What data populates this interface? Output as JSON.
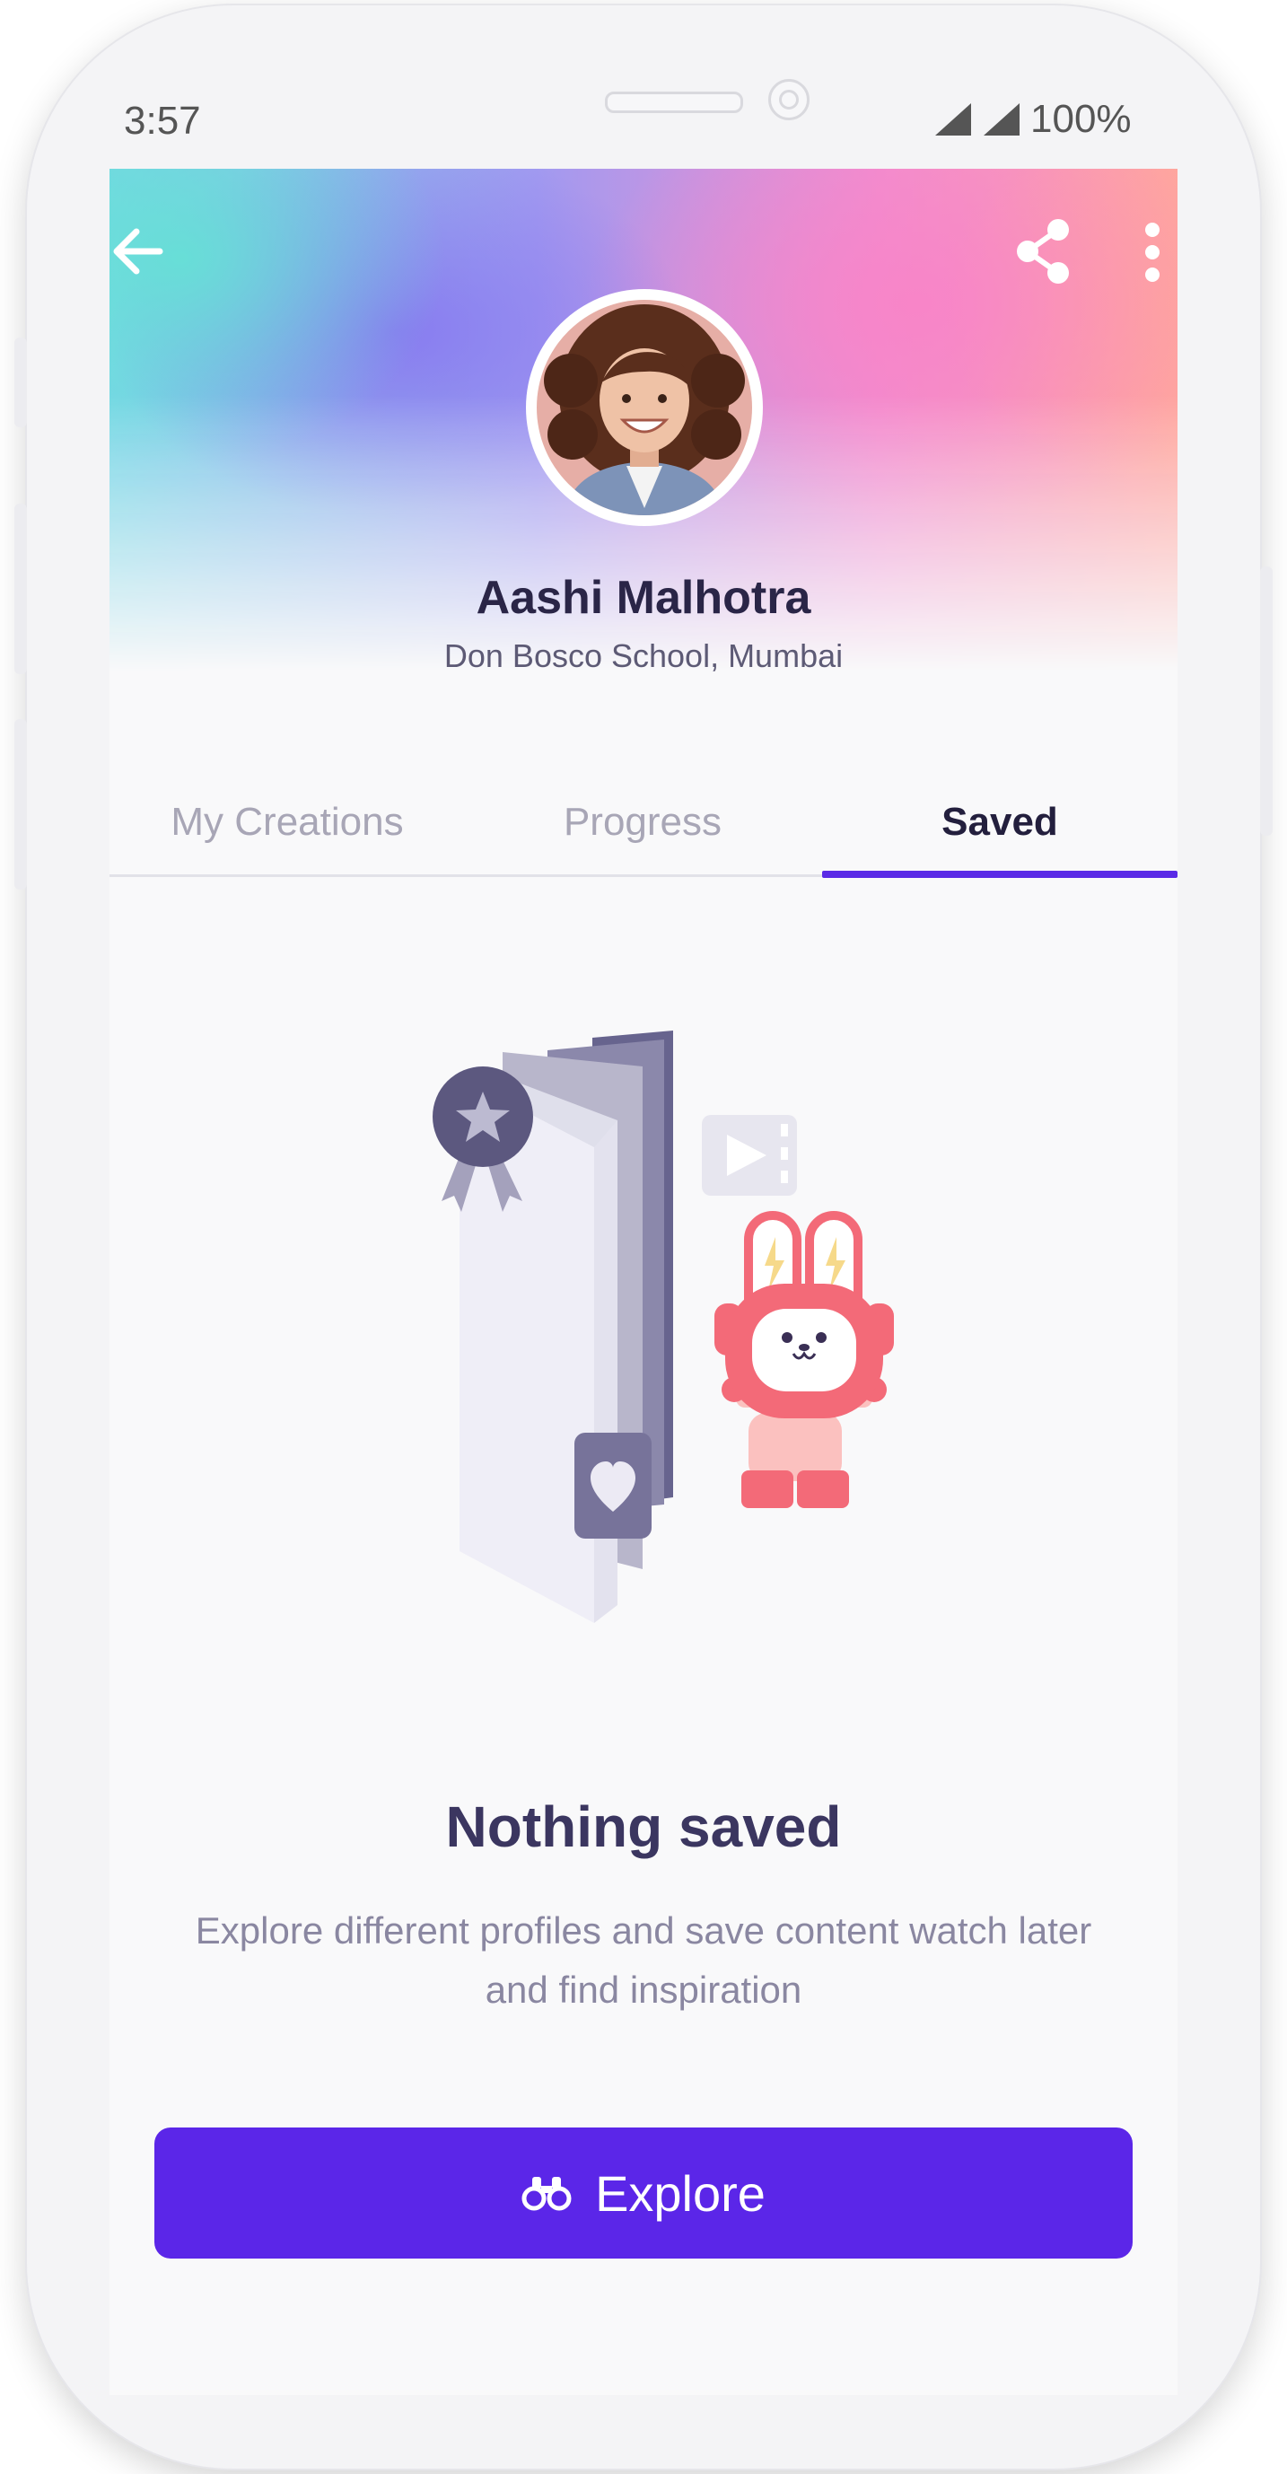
{
  "status_bar": {
    "time": "3:57",
    "battery": "100%"
  },
  "profile": {
    "name": "Aashi Malhotra",
    "school": "Don Bosco School, Mumbai"
  },
  "tabs": [
    {
      "label": "My Creations",
      "active": false
    },
    {
      "label": "Progress",
      "active": false
    },
    {
      "label": "Saved",
      "active": true
    }
  ],
  "empty_state": {
    "title": "Nothing saved",
    "description": "Explore different profiles and save content watch later and find inspiration"
  },
  "explore_button": {
    "label": "Explore",
    "icon": "binoculars-icon"
  },
  "colors": {
    "accent": "#5b26e8",
    "title": "#2a2547",
    "bunny": "#f36a78"
  }
}
